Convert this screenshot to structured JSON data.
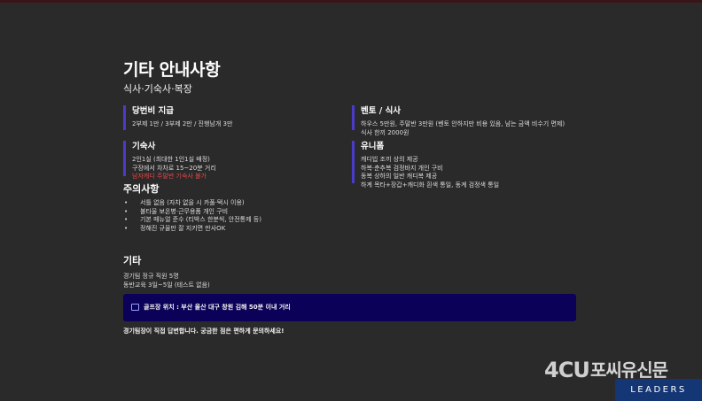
{
  "header": {
    "title": "기타 안내사항",
    "subtitle": "식사·기숙사·복장"
  },
  "cards": {
    "allowance": {
      "title": "당번비 지급",
      "lines": [
        "2부제 1만 / 3부제 2만 / 진행남개 3만"
      ]
    },
    "bento": {
      "title": "벤토 / 식사",
      "lines": [
        "하우스 5만원, 주말반 3만원 (벤토 안하지만 비용 있음, 남는 금액 비수기 면제)",
        "식사 한끼 2000원"
      ]
    },
    "dorm": {
      "title": "기숙사",
      "lines": [
        "2인1실 (최대한 1인1실 배정)",
        "구장에서 차차로 15~20분 거리"
      ],
      "warning": "남자캐디 주말반 기숙사 불가"
    },
    "uniform": {
      "title": "유니폼",
      "lines": [
        "캐디빕 조끼 상의 제공",
        "하복·춘추복 검정바지 개인 구비",
        "동복 상하의 일반 캐디복 제공",
        "하계 목타+장갑+캐디화 흰색 통일, 동계 검정색 통일"
      ]
    }
  },
  "caution": {
    "title": "주의사항",
    "items": [
      "서틀 없음 (자차 없을 시 카풀·택시 이용)",
      "불타울 보온병·근무용품 개인 구비",
      "기본 매뉴얼 준수 (티박스 한분씩, 안전통제 등)",
      "정해진 규율만 잘 지키면 만사OK"
    ]
  },
  "etc": {
    "title": "기타",
    "lines": [
      "경기팀 정규 직원 5명",
      "동반교육 3일~5일 (테스트 없음)"
    ]
  },
  "notice": {
    "icon": "square-icon",
    "text": "골프장 위치 : 부산 울산 대구 창원 김해 50분 이내 거리"
  },
  "footer": {
    "note": "경기팀장이 직접 답변합니다. 궁금한 점은 편하게 문의하세요!"
  },
  "brand": {
    "logo": "4CU",
    "name": "포씨유신문",
    "tagline": "LEADERS"
  },
  "colors": {
    "background": "#2b2a2b",
    "accent_bar": "#4a3cc8",
    "notice_bg": "#0b0158",
    "warning": "#e54848",
    "brand_band": "#143674"
  }
}
